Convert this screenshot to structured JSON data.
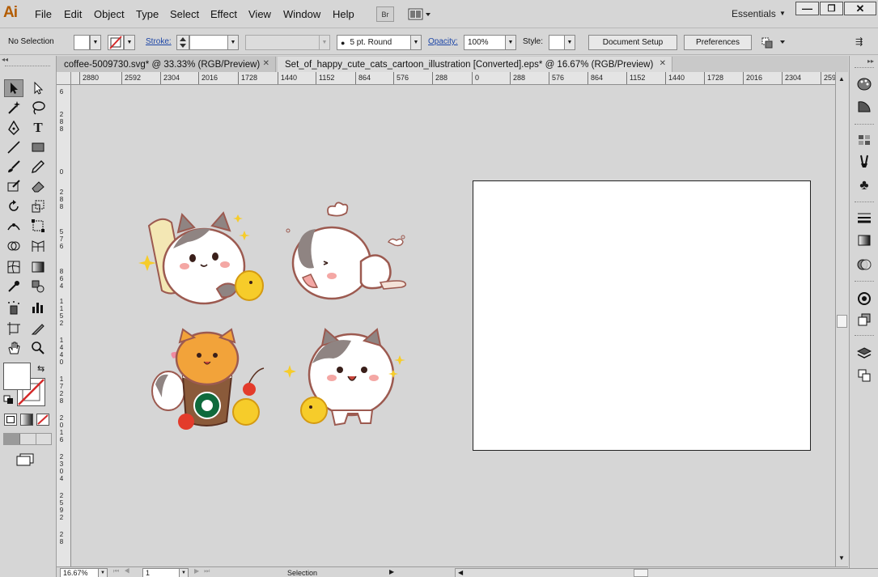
{
  "app": {
    "logo": "Ai",
    "bridge_label": "Br",
    "workspace": "Essentials"
  },
  "menu": [
    "File",
    "Edit",
    "Object",
    "Type",
    "Select",
    "Effect",
    "View",
    "Window",
    "Help"
  ],
  "window_controls": {
    "minimize": "—",
    "restore": "❐",
    "close": "✕"
  },
  "control_bar": {
    "selection_state": "No Selection",
    "stroke_label": "Stroke:",
    "brush": "5 pt. Round",
    "opacity_label": "Opacity:",
    "opacity_value": "100%",
    "style_label": "Style:",
    "document_setup": "Document Setup",
    "preferences": "Preferences"
  },
  "tabs": [
    {
      "label": "coffee-5009730.svg* @ 33.33% (RGB/Preview)",
      "active": false
    },
    {
      "label": "Set_of_happy_cute_cats_cartoon_illustration [Converted].eps* @ 16.67% (RGB/Preview)",
      "active": true
    }
  ],
  "ruler": {
    "top_labels": [
      "2880",
      "2592",
      "2304",
      "2016",
      "1728",
      "1440",
      "1152",
      "864",
      "576",
      "288",
      "0",
      "288",
      "576",
      "864",
      "1152",
      "1440",
      "1728",
      "2016",
      "2304",
      "259"
    ],
    "left_labels": [
      "6",
      "2 8 8",
      "0",
      "2 8 8",
      "5 7 6",
      "8 6 4",
      "1 1 5 2",
      "1 4 4 0",
      "1 7 2 8",
      "2 0 1 6",
      "2 3 0 4",
      "2 5 9 2",
      "2 8"
    ]
  },
  "status": {
    "zoom": "16.67%",
    "artboard_number": "1",
    "tool_name": "Selection"
  },
  "colors": {
    "fill": "#ffffff",
    "stroke_none": "#d42a2a",
    "accent_link": "#1c45a6",
    "cat_outline": "#9c5a50",
    "cat_gray": "#8f8482",
    "cat_orange": "#f2a33a",
    "chick_yellow": "#f6cc2a",
    "starbucks_green": "#0f6a3c"
  },
  "artwork": {
    "description_icons": [
      "cat-with-scroll",
      "cat-lying",
      "cat-with-coffee-cup",
      "cat-with-chick"
    ]
  }
}
